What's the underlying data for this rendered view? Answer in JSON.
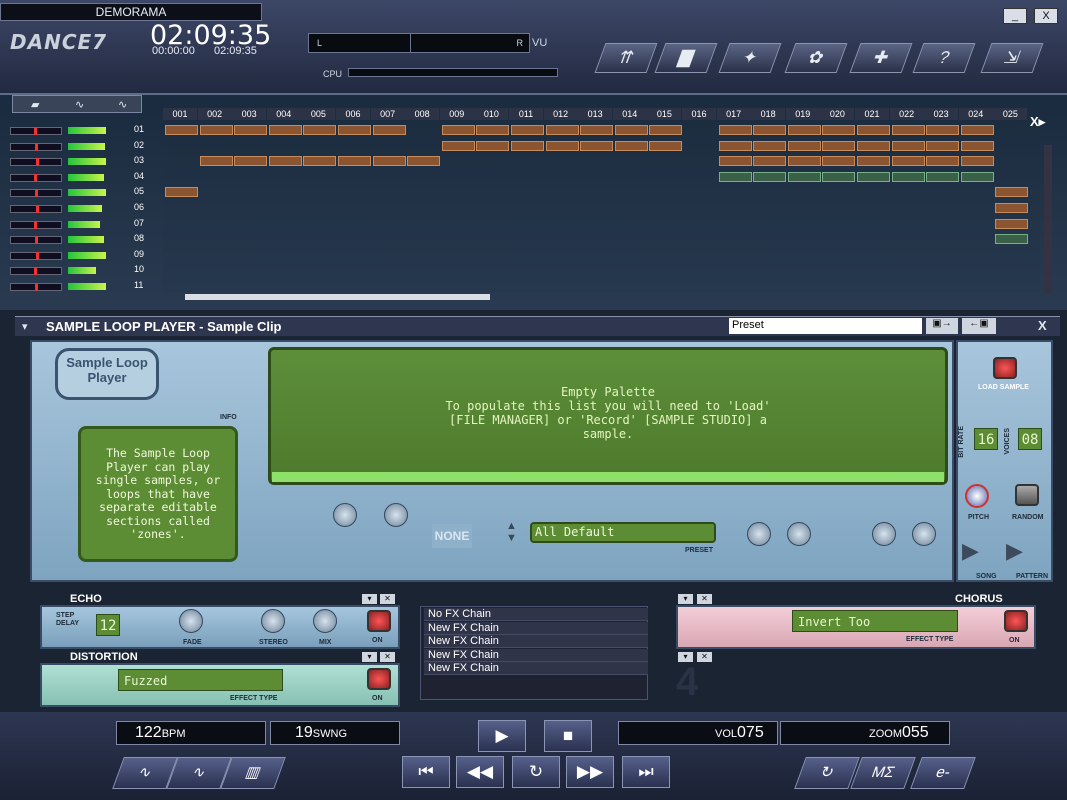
{
  "app": {
    "song_name": "DEMORAMA",
    "logo": "DANCE7",
    "time_main": "02:09:35",
    "time_start": "00:00:00",
    "time_end": "02:09:35",
    "meter_l": "L",
    "meter_r": "R",
    "vu_label": "VU",
    "cpu_label": "CPU",
    "minimize": "_",
    "close": "X"
  },
  "toolbar": {
    "icons": [
      "sort-icon",
      "folder-icon",
      "mixer-icon",
      "sampler-icon",
      "puzzle-icon",
      "help-icon",
      "arrange-icon"
    ],
    "glyphs": [
      "⇈",
      "▇",
      "✦",
      "✿",
      "✚",
      "?",
      "⇲"
    ]
  },
  "tracks": {
    "columns": [
      "001",
      "002",
      "003",
      "004",
      "005",
      "006",
      "007",
      "008",
      "009",
      "010",
      "011",
      "012",
      "013",
      "014",
      "015",
      "016",
      "017",
      "018",
      "019",
      "020",
      "021",
      "022",
      "023",
      "024",
      "025"
    ],
    "numbers": [
      "01",
      "02",
      "03",
      "04",
      "05",
      "06",
      "07",
      "08",
      "09",
      "10",
      "11"
    ],
    "levels": [
      38,
      37,
      38,
      36,
      38,
      34,
      32,
      36,
      38,
      28,
      38
    ],
    "expand_label": "X▸"
  },
  "plugin": {
    "title": "SAMPLE LOOP PLAYER - Sample Clip",
    "preset_value": "Preset",
    "close": "X",
    "logo_text": "Sample Loop Player",
    "info_label": "INFO",
    "info_text": "The Sample Loop Player can play single samples, or loops that have separate editable sections called 'zones'.",
    "screen_title": "Empty Palette",
    "screen_text": "To populate this list you will need to 'Load' [FILE MANAGER] or 'Record' [SAMPLE STUDIO] a sample.",
    "preset_lcd": "All Default",
    "preset_label": "PRESET",
    "none_label": "NONE",
    "load_sample": "LOAD SAMPLE",
    "bit_rate_label": "BIT RATE",
    "bit_rate": "16",
    "voices_label": "VOICES",
    "voices": "08",
    "pitch": "PITCH",
    "random": "RANDOM",
    "song": "SONG",
    "pattern": "PATTERN"
  },
  "effects": {
    "echo": {
      "title": "ECHO",
      "step_delay_label": "STEP DELAY",
      "step_delay": "12",
      "fade": "FADE",
      "stereo": "STEREO",
      "mix": "MIX",
      "on": "ON"
    },
    "distortion": {
      "title": "DISTORTION",
      "type_value": "Fuzzed",
      "type_label": "EFFECT TYPE",
      "on": "ON"
    },
    "chorus": {
      "title": "CHORUS",
      "type_value": "Invert Too",
      "type_label": "EFFECT TYPE",
      "on": "ON"
    },
    "chain": [
      "No FX Chain",
      "New FX Chain",
      "New FX Chain",
      "New FX Chain",
      "New FX Chain"
    ],
    "slot_number": "4"
  },
  "transport": {
    "bpm": "122",
    "bpm_unit": "BPM",
    "swing": "19",
    "swing_unit": "SWNG",
    "vol_label": "VOL",
    "vol": "075",
    "zoom_label": "ZOOM",
    "zoom": "055",
    "play": "▶",
    "stop": "■",
    "rewind_start": "⏮",
    "rewind": "◀◀",
    "loop": "↻",
    "forward": "▶▶",
    "end": "⏭"
  },
  "bottom": {
    "left_buttons": [
      "∿",
      "∿",
      "▥"
    ],
    "right_buttons": [
      "↻",
      "MΣ",
      "e-"
    ]
  }
}
